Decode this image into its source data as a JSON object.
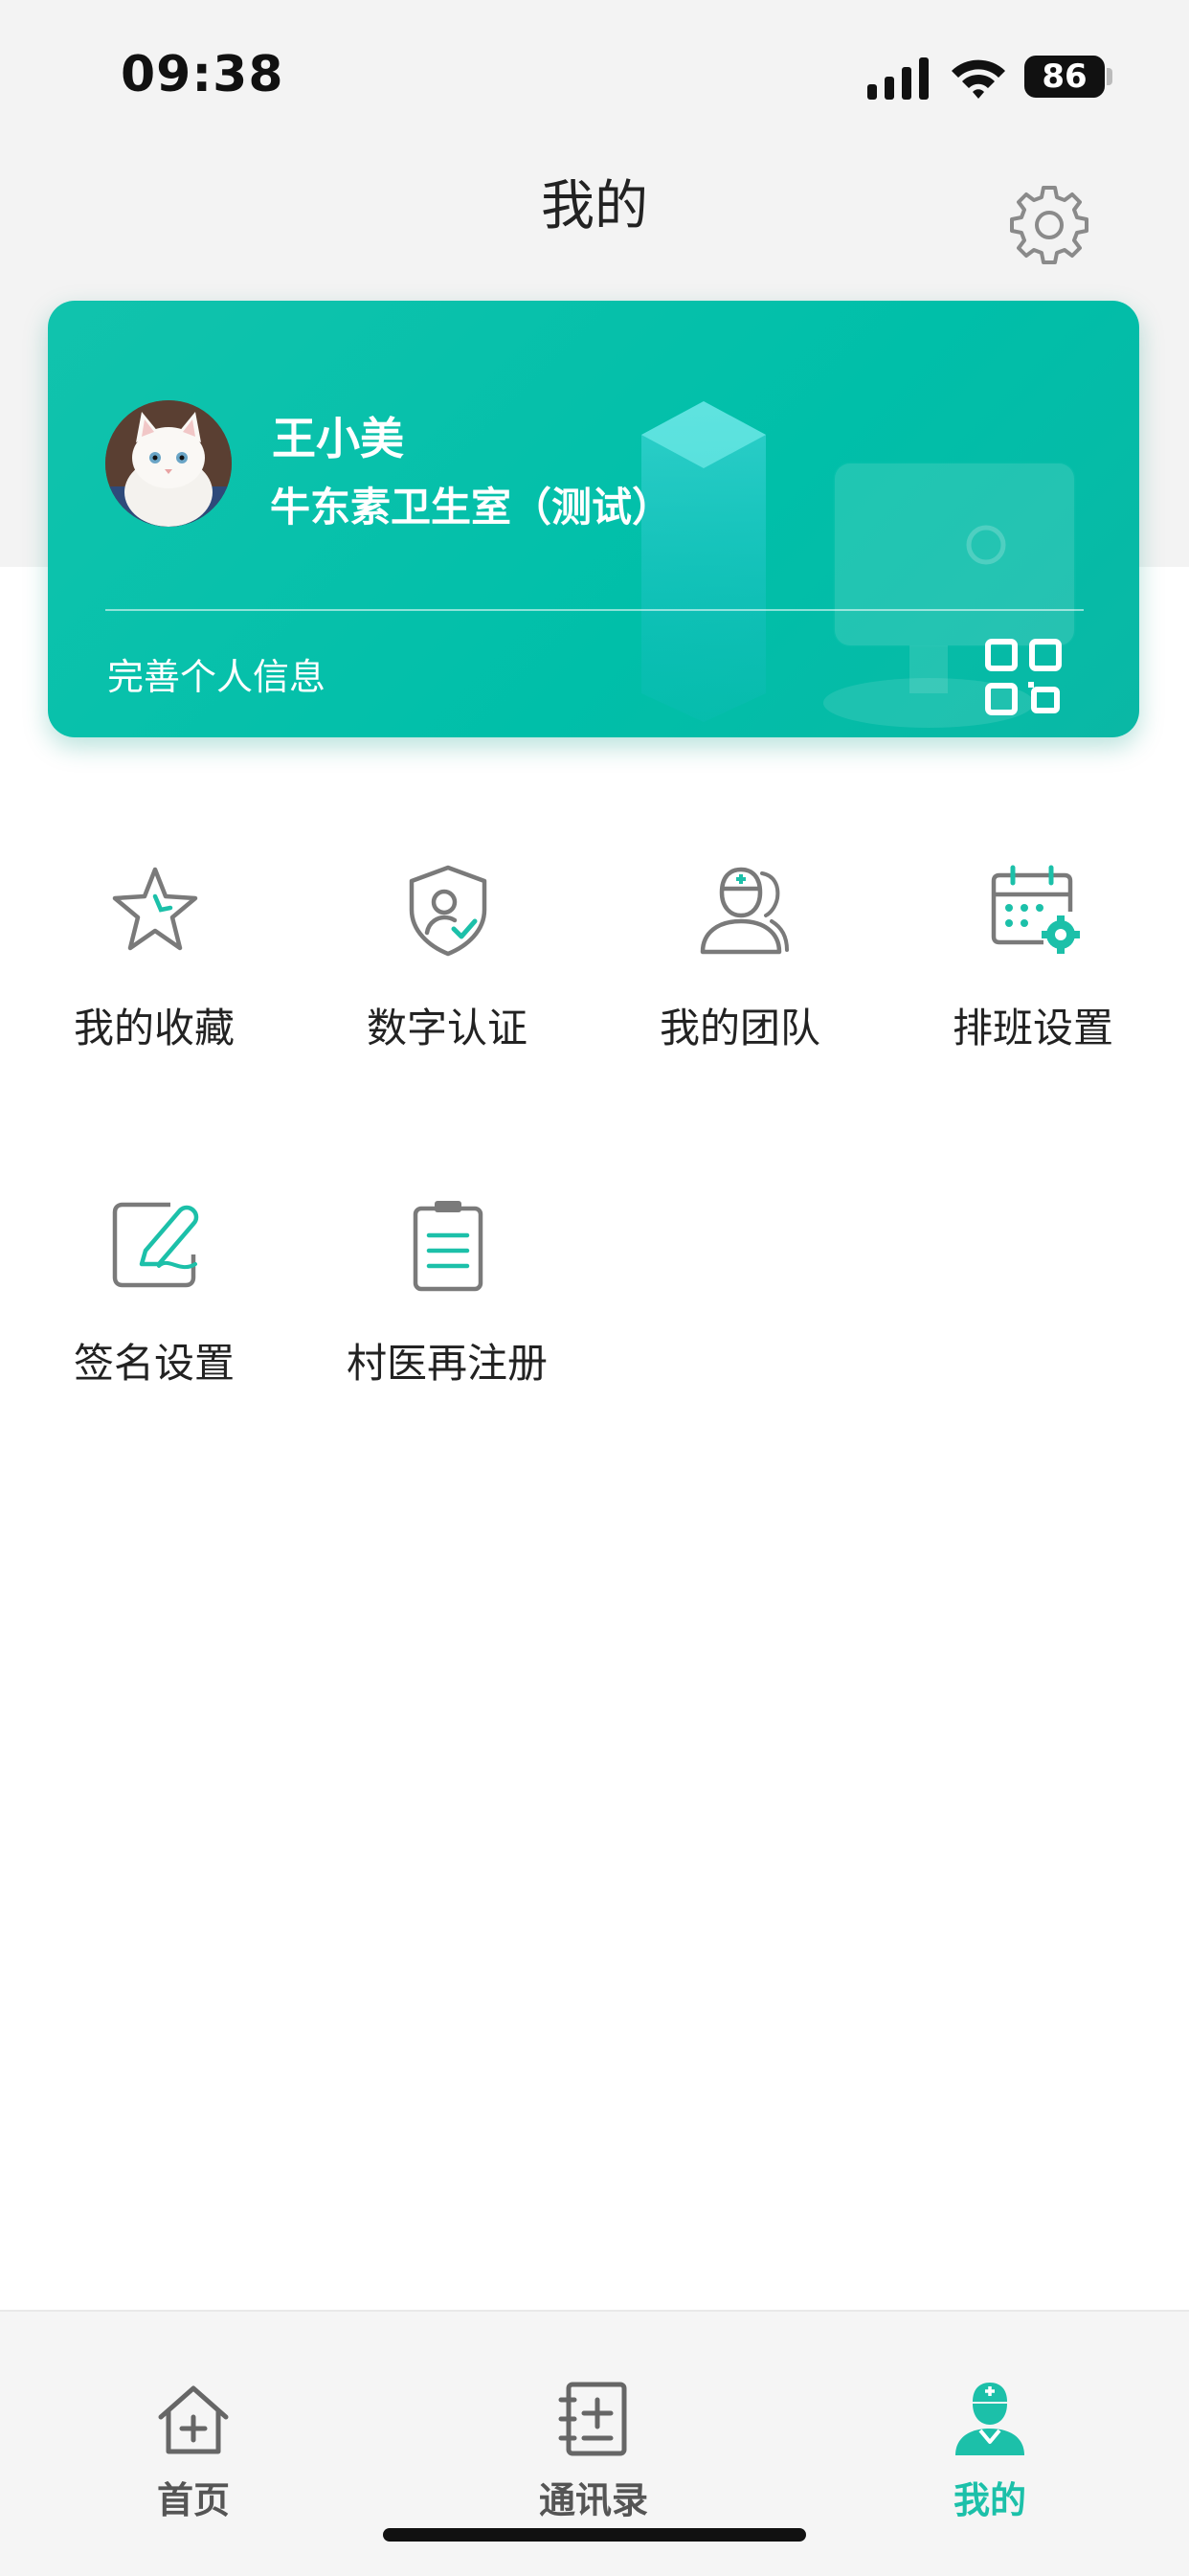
{
  "status_bar": {
    "time": "09:38",
    "battery": "86"
  },
  "header": {
    "title": "我的",
    "settings_icon": "gear-icon"
  },
  "profile": {
    "name": "王小美",
    "organization": "牛东素卫生室（测试）",
    "complete_info_label": "完善个人信息",
    "qr_icon": "qr-code-icon"
  },
  "menu": {
    "items": [
      {
        "label": "我的收藏",
        "icon": "star-icon"
      },
      {
        "label": "数字认证",
        "icon": "shield-user-check-icon"
      },
      {
        "label": "我的团队",
        "icon": "doctor-team-icon"
      },
      {
        "label": "排班设置",
        "icon": "calendar-gear-icon"
      },
      {
        "label": "签名设置",
        "icon": "signature-pen-icon"
      },
      {
        "label": "村医再注册",
        "icon": "clipboard-list-icon"
      }
    ]
  },
  "tabbar": {
    "active": "我的",
    "tabs": [
      {
        "label": "首页",
        "icon": "home-plus-icon"
      },
      {
        "label": "通讯录",
        "icon": "contacts-book-icon"
      },
      {
        "label": "我的",
        "icon": "doctor-profile-icon"
      }
    ]
  },
  "colors": {
    "accent": "#1cc0a9",
    "card": "#00bfa9",
    "icon_gray": "#7a7a7a"
  }
}
